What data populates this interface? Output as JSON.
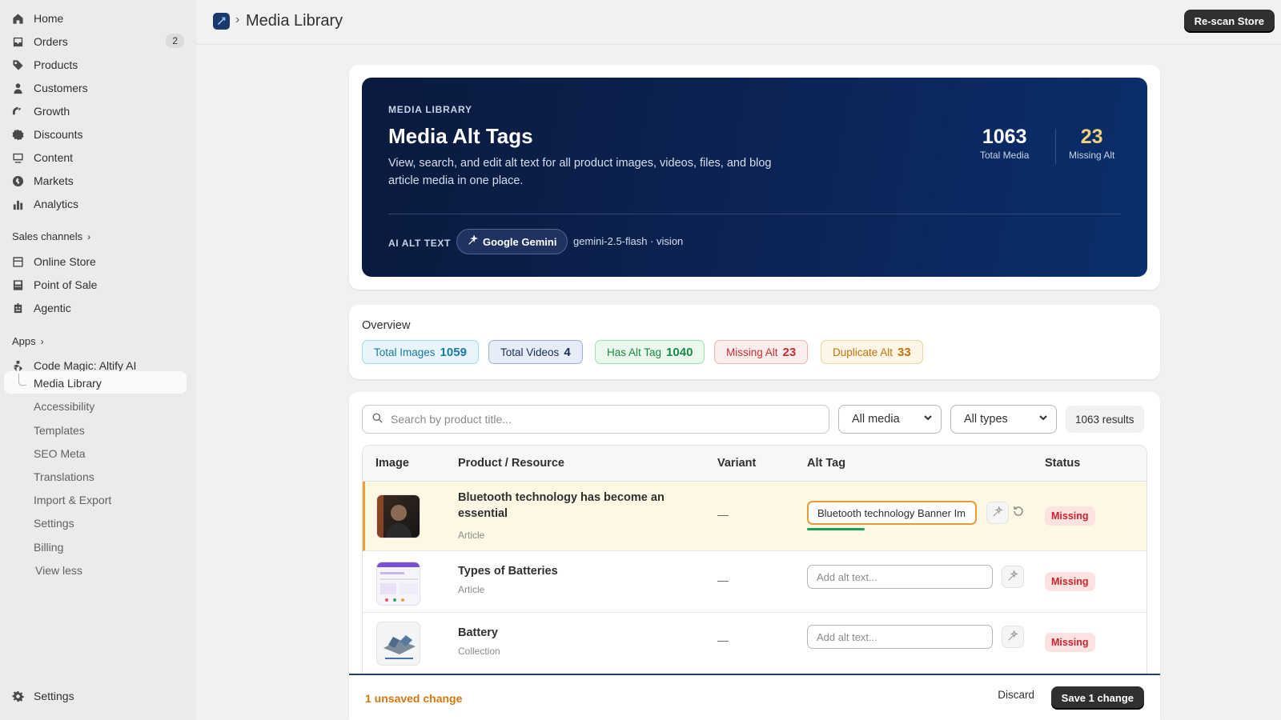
{
  "sidebar": {
    "nav": [
      {
        "label": "Home",
        "icon": "home-icon"
      },
      {
        "label": "Orders",
        "icon": "inbox-icon",
        "badge": "2"
      },
      {
        "label": "Products",
        "icon": "tag-icon"
      },
      {
        "label": "Customers",
        "icon": "person-icon"
      },
      {
        "label": "Growth",
        "icon": "gauge-icon"
      },
      {
        "label": "Discounts",
        "icon": "discount-icon"
      },
      {
        "label": "Content",
        "icon": "content-icon"
      },
      {
        "label": "Markets",
        "icon": "globe-icon"
      },
      {
        "label": "Analytics",
        "icon": "bar-chart-icon"
      }
    ],
    "sales_channels_label": "Sales channels",
    "channels": [
      {
        "label": "Online Store",
        "icon": "store-icon"
      },
      {
        "label": "Point of Sale",
        "icon": "pos-icon"
      },
      {
        "label": "Agentic",
        "icon": "robot-icon"
      }
    ],
    "apps_label": "Apps",
    "app_name": "Code Magic: Altify AI",
    "app_items": [
      "Media Library",
      "Accessibility",
      "Templates",
      "SEO Meta",
      "Translations",
      "Import & Export",
      "Settings",
      "Billing"
    ],
    "view_less": "View less",
    "settings": "Settings"
  },
  "header": {
    "title": "Media Library",
    "rescan_label": "Re-scan Store"
  },
  "hero": {
    "eyebrow": "MEDIA LIBRARY",
    "title": "Media Alt Tags",
    "description": "View, search, and edit alt text for all product images, videos, files, and blog article media in one place.",
    "total_media": "1063",
    "total_media_label": "Total Media",
    "missing_alt": "23",
    "missing_alt_label": "Missing Alt",
    "ai_label": "AI ALT TEXT",
    "provider": "Google Gemini",
    "model": "gemini-2.5-flash · vision"
  },
  "overview": {
    "title": "Overview",
    "pills": [
      {
        "label": "Total Images",
        "count": "1059"
      },
      {
        "label": "Total Videos",
        "count": "4"
      },
      {
        "label": "Has Alt Tag",
        "count": "1040"
      },
      {
        "label": "Missing Alt",
        "count": "23"
      },
      {
        "label": "Duplicate Alt",
        "count": "33"
      }
    ]
  },
  "filters": {
    "search_placeholder": "Search by product title...",
    "media_select": "All media",
    "type_select": "All types",
    "results": "1063 results"
  },
  "table": {
    "headers": [
      "Image",
      "Product / Resource",
      "Variant",
      "Alt Tag",
      "Status"
    ],
    "rows": [
      {
        "title": "Bluetooth technology has become an essential",
        "type": "Article",
        "variant": "—",
        "alt": "Bluetooth technology Banner Im",
        "status": "Missing"
      },
      {
        "title": "Types of Batteries",
        "type": "Article",
        "variant": "—",
        "alt_placeholder": "Add alt text...",
        "status": "Missing"
      },
      {
        "title": "Battery",
        "type": "Collection",
        "variant": "—",
        "alt_placeholder": "Add alt text...",
        "status": "Missing"
      }
    ]
  },
  "save_bar": {
    "unsaved": "1 unsaved change",
    "discard": "Discard",
    "save": "Save 1 change"
  }
}
